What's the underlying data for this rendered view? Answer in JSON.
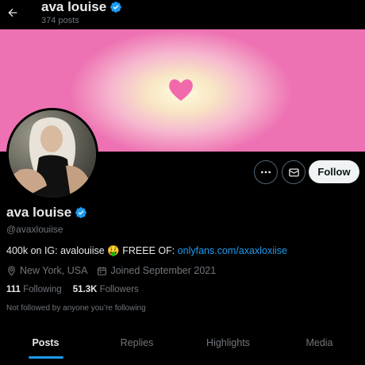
{
  "header": {
    "title": "ava louise",
    "post_count": "374 posts"
  },
  "profile": {
    "name": "ava louise",
    "handle": "@avaxlouiise",
    "bio_prefix": "400k on IG: avalouiise",
    "bio_emoji": "🤑",
    "bio_middle": " FREEE OF: ",
    "bio_link": "onlyfans.com/axaxloxiise",
    "location": "New York, USA",
    "joined": "Joined September 2021",
    "following_count": "111",
    "following_label": "Following",
    "followers_count": "51.3K",
    "followers_label": "Followers",
    "not_followed_note": "Not followed by anyone you’re following"
  },
  "actions": {
    "follow_label": "Follow"
  },
  "tabs": [
    {
      "label": "Posts",
      "active": true
    },
    {
      "label": "Replies",
      "active": false
    },
    {
      "label": "Highlights",
      "active": false
    },
    {
      "label": "Media",
      "active": false
    }
  ],
  "colors": {
    "accent": "#1d9bf0",
    "banner_pink": "#ee72b3",
    "background": "#000000"
  },
  "icons": {
    "back": "arrow-left-icon",
    "verified": "verified-badge-icon",
    "more": "more-icon",
    "message": "mail-icon",
    "location": "location-pin-icon",
    "calendar": "calendar-icon"
  }
}
